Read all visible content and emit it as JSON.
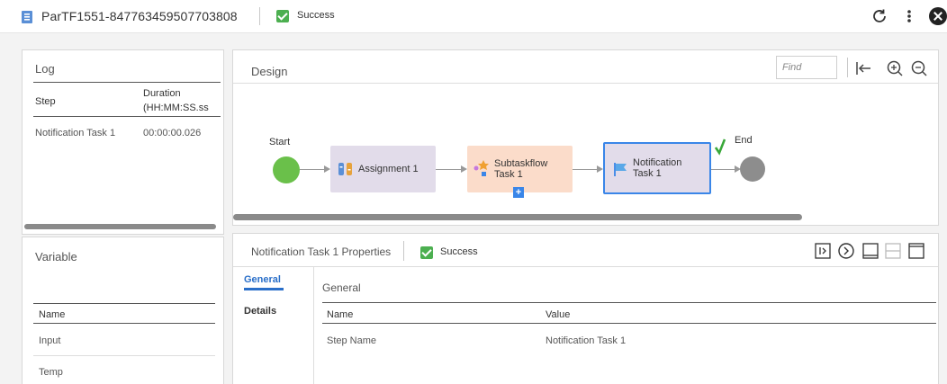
{
  "header": {
    "title": "ParTF1551-847763459507703808",
    "status": "Success"
  },
  "log": {
    "title": "Log",
    "col_step": "Step",
    "col_duration": "Duration (HH:MM:SS.ss",
    "rows": [
      {
        "step": "Notification Task 1",
        "duration": "00:00:00.026"
      }
    ]
  },
  "design": {
    "title": "Design",
    "find_placeholder": "Find",
    "start_label": "Start",
    "end_label": "End",
    "tasks": [
      {
        "label_line1": "Assignment 1",
        "label_line2": ""
      },
      {
        "label_line1": "Subtaskflow",
        "label_line2": "Task 1"
      },
      {
        "label_line1": "Notification",
        "label_line2": "Task 1"
      }
    ]
  },
  "variable": {
    "title": "Variable",
    "col_name": "Name",
    "rows": [
      "Input",
      "Temp"
    ]
  },
  "properties": {
    "title": "Notification Task 1 Properties",
    "status": "Success",
    "tabs": [
      "General",
      "Details"
    ],
    "section_title": "General",
    "col_name": "Step Name",
    "col_value": "Value",
    "header_name": "Name",
    "rows": [
      {
        "name": "Step Name",
        "value": "Notification Task 1"
      }
    ]
  },
  "colors": {
    "success": "#4caf50",
    "accent": "#2a6fc9",
    "assignment_bg": "#e2dcea",
    "subtask_bg": "#fbdcca",
    "start": "#6ac04a",
    "end": "#8d8d8d"
  },
  "icons": [
    "taskflow-icon",
    "refresh-icon",
    "more-vert-icon",
    "close-icon",
    "fit-left-icon",
    "zoom-in-icon",
    "zoom-out-icon",
    "assignment-icon",
    "subtaskflow-icon",
    "notification-flag-icon",
    "expand-icon",
    "resume-icon",
    "layout-bottom-icon",
    "layout-split-icon",
    "layout-top-icon"
  ]
}
